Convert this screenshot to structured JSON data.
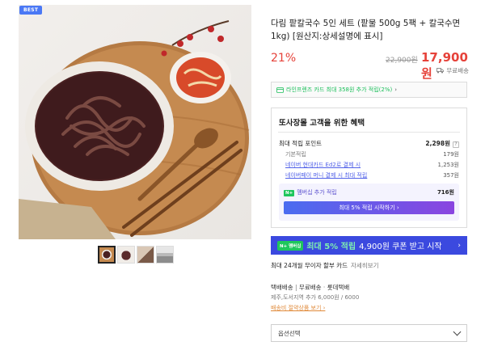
{
  "badge": "BEST",
  "product": {
    "title": "다림 팥칼국수 5인 세트 (팥물 500g 5팩 + 칼국수면 1kg) [원산지:상세설명에 표시]",
    "discount": "21%",
    "original_price": "22,900원",
    "price": "17,900원",
    "shipping": "무료배송"
  },
  "card_banner": {
    "text": "라인프렌즈 카드 최대 358원 추가 적립(2%)",
    "arrow": "›"
  },
  "benefit": {
    "title": "또사장몰 고객을 위한 혜택",
    "max_points_label": "최대 적립 포인트",
    "max_points_value": "2,298원",
    "basic_label": "기본적립",
    "basic_value": "179원",
    "hyundai_label": "네이버 현대카드 Ed2로 결제 시",
    "hyundai_value": "1,253원",
    "money_label": "네이버페이 머니 결제 시 최대 적립",
    "money_value": "357원",
    "membership_tag": "N+",
    "membership_label": "멤버십 추가 적립",
    "membership_value": "716원",
    "membership_button": "최대 5% 적립 시작하기 ›"
  },
  "coupon_bar": {
    "pill": "N+ 멤버십",
    "text_highlight": "최대 5% 적립",
    "text_rest": "4,900원 쿠폰 받고 시작",
    "arrow": "›"
  },
  "installment": {
    "label": "최대 24개월 무이자 할부 카드",
    "link": "자세히보기"
  },
  "delivery": {
    "label": "택배배송",
    "sep": "|",
    "free": "무료배송",
    "sep2": "·",
    "carrier": "롯데택배",
    "extra": "제주,도서지역 추가 6,000원 / 6000",
    "view_link": "배송비 절약상품 보기 ›"
  },
  "option_select": {
    "placeholder": "옵션선택"
  },
  "thumbnails": [
    "thumb-1",
    "thumb-2",
    "thumb-3",
    "thumb-4"
  ]
}
